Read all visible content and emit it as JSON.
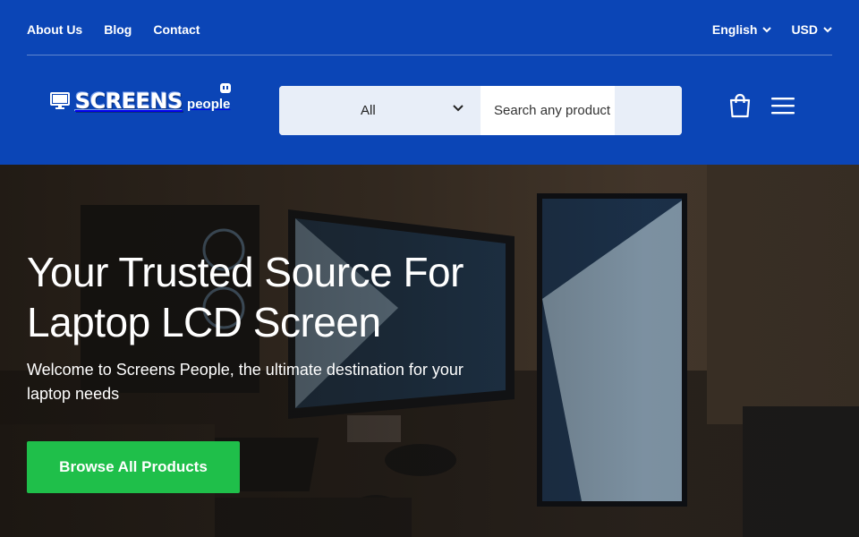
{
  "topbar": {
    "links": [
      "About Us",
      "Blog",
      "Contact"
    ],
    "language": "English",
    "currency": "USD"
  },
  "logo": {
    "word": "SCREENS",
    "tagline": "people"
  },
  "search": {
    "category": "All",
    "placeholder": "Search any product"
  },
  "hero": {
    "title": "Your Trusted Source For Laptop LCD Screen",
    "subtitle": "Welcome to Screens People, the ultimate destination for your laptop needs",
    "cta_label": "Browse All Products"
  },
  "colors": {
    "brand_blue": "#0b45b6",
    "cta_green": "#1fbf4a"
  }
}
